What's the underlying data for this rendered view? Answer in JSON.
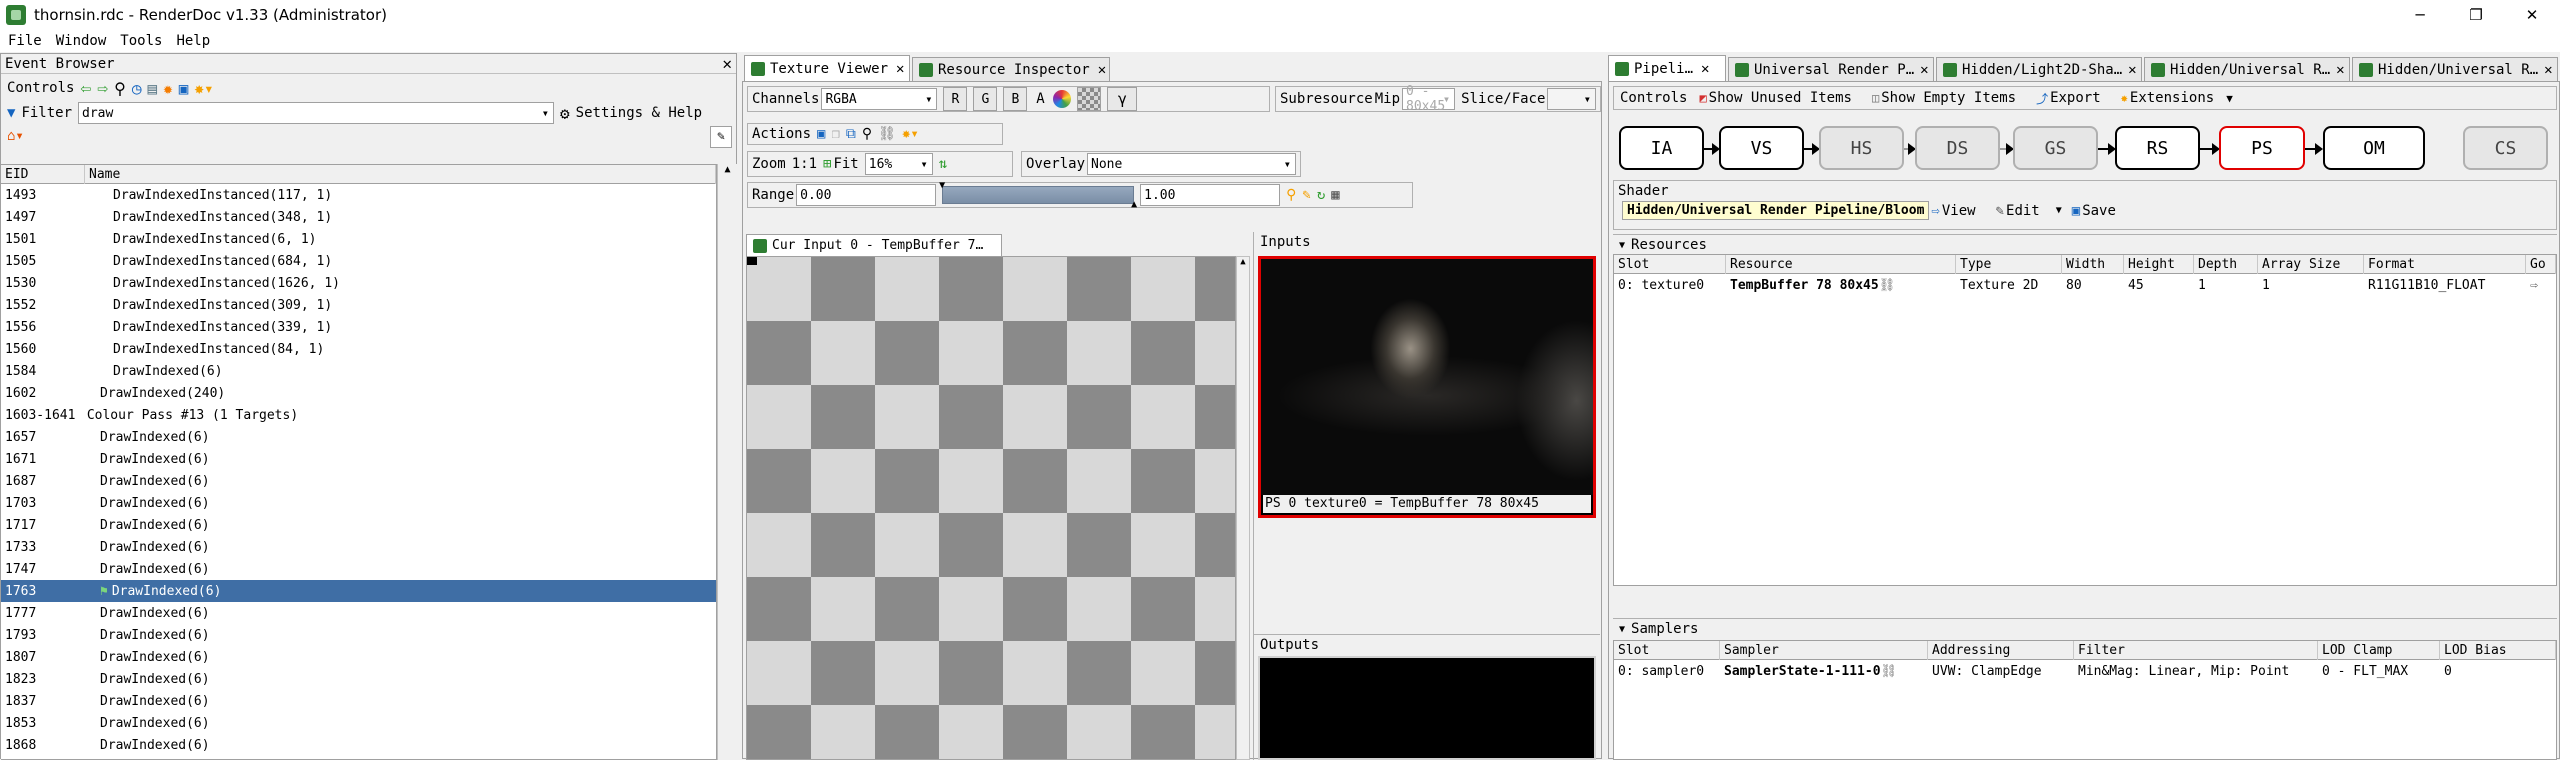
{
  "window": {
    "title": "thornsin.rdc - RenderDoc v1.33 (Administrator)",
    "minimize": "─",
    "maximize": "❐",
    "close": "✕"
  },
  "menu": [
    "File",
    "Window",
    "Tools",
    "Help"
  ],
  "event_browser": {
    "title": "Event Browser",
    "controls_label": "Controls",
    "filter_label": "Filter",
    "filter_value": "draw",
    "settings_help": "Settings & Help",
    "columns": [
      "EID",
      "Name"
    ],
    "rows": [
      {
        "eid": "1493",
        "name": "DrawIndexedInstanced(117, 1)",
        "indent": 2
      },
      {
        "eid": "1497",
        "name": "DrawIndexedInstanced(348, 1)",
        "indent": 2
      },
      {
        "eid": "1501",
        "name": "DrawIndexedInstanced(6, 1)",
        "indent": 2
      },
      {
        "eid": "1505",
        "name": "DrawIndexedInstanced(684, 1)",
        "indent": 2
      },
      {
        "eid": "1530",
        "name": "DrawIndexedInstanced(1626, 1)",
        "indent": 2
      },
      {
        "eid": "1552",
        "name": "DrawIndexedInstanced(309, 1)",
        "indent": 2
      },
      {
        "eid": "1556",
        "name": "DrawIndexedInstanced(339, 1)",
        "indent": 2
      },
      {
        "eid": "1560",
        "name": "DrawIndexedInstanced(84, 1)",
        "indent": 2
      },
      {
        "eid": "1584",
        "name": "DrawIndexed(6)",
        "indent": 2
      },
      {
        "eid": "1602",
        "name": "DrawIndexed(240)",
        "indent": 1
      },
      {
        "eid": "1603-1641",
        "name": "Colour Pass #13 (1 Targets)",
        "indent": 0,
        "expander": "›"
      },
      {
        "eid": "1657",
        "name": "DrawIndexed(6)",
        "indent": 1
      },
      {
        "eid": "1671",
        "name": "DrawIndexed(6)",
        "indent": 1
      },
      {
        "eid": "1687",
        "name": "DrawIndexed(6)",
        "indent": 1
      },
      {
        "eid": "1703",
        "name": "DrawIndexed(6)",
        "indent": 1
      },
      {
        "eid": "1717",
        "name": "DrawIndexed(6)",
        "indent": 1
      },
      {
        "eid": "1733",
        "name": "DrawIndexed(6)",
        "indent": 1
      },
      {
        "eid": "1747",
        "name": "DrawIndexed(6)",
        "indent": 1
      },
      {
        "eid": "1763",
        "name": "DrawIndexed(6)",
        "indent": 1,
        "selected": true
      },
      {
        "eid": "1777",
        "name": "DrawIndexed(6)",
        "indent": 1
      },
      {
        "eid": "1793",
        "name": "DrawIndexed(6)",
        "indent": 1
      },
      {
        "eid": "1807",
        "name": "DrawIndexed(6)",
        "indent": 1
      },
      {
        "eid": "1823",
        "name": "DrawIndexed(6)",
        "indent": 1
      },
      {
        "eid": "1837",
        "name": "DrawIndexed(6)",
        "indent": 1
      },
      {
        "eid": "1853",
        "name": "DrawIndexed(6)",
        "indent": 1
      },
      {
        "eid": "1868",
        "name": "DrawIndexed(6)",
        "indent": 1
      }
    ]
  },
  "texture_viewer": {
    "tabs": [
      "Texture Viewer",
      "Resource Inspector"
    ],
    "channels_label": "Channels",
    "channels_value": "RGBA",
    "channel_buttons": [
      "R",
      "G",
      "B",
      "A"
    ],
    "gamma": "γ",
    "subresource_label": "Subresource",
    "mip_label": "Mip",
    "mip_value": "0 - 80x45",
    "slice_label": "Slice/Face",
    "actions_label": "Actions",
    "zoom_label": "Zoom",
    "zoom_1to1": "1:1",
    "fit_label": "Fit",
    "zoom_value": "16%",
    "overlay_label": "Overlay",
    "overlay_value": "None",
    "range_label": "Range",
    "range_min": "0.00",
    "range_max": "1.00",
    "image_tab": "Cur Input 0 - TempBuffer 7…",
    "inputs_label": "Inputs",
    "input_caption": "PS 0    texture0 = TempBuffer 78 80x45",
    "outputs_label": "Outputs"
  },
  "pipeline": {
    "tabs": [
      "Pipeli…",
      "Universal Render P…",
      "Hidden/Light2D-Sha…",
      "Hidden/Universal R…",
      "Hidden/Universal R…"
    ],
    "controls_label": "Controls",
    "show_unused": "Show Unused Items",
    "show_empty": "Show Empty Items",
    "export": "Export",
    "extensions": "Extensions",
    "stages": [
      "IA",
      "VS",
      "HS",
      "DS",
      "GS",
      "RS",
      "PS",
      "OM",
      "CS"
    ],
    "shader_label": "Shader",
    "shader_name": "Hidden/Universal Render Pipeline/Bloom",
    "view": "View",
    "edit": "Edit",
    "save": "Save",
    "resources_label": "Resources",
    "resources_columns": [
      "Slot",
      "Resource",
      "Type",
      "Width",
      "Height",
      "Depth",
      "Array Size",
      "Format",
      "Go"
    ],
    "resources_rows": [
      [
        "0: texture0",
        "TempBuffer 78 80x45",
        "Texture 2D",
        "80",
        "45",
        "1",
        "1",
        "R11G11B10_FLOAT"
      ]
    ],
    "samplers_label": "Samplers",
    "samplers_columns": [
      "Slot",
      "Sampler",
      "Addressing",
      "Filter",
      "LOD Clamp",
      "LOD Bias"
    ],
    "samplers_rows": [
      [
        "0: sampler0",
        "SamplerState-1-111-0",
        "UVW: ClampEdge",
        "Min&Mag: Linear, Mip: Point",
        "0 - FLT_MAX",
        "0"
      ]
    ]
  },
  "colors": {
    "selection": "#3f6ea5",
    "highlight_stage": "#e00000",
    "shader_bg": "#fffdd0"
  }
}
